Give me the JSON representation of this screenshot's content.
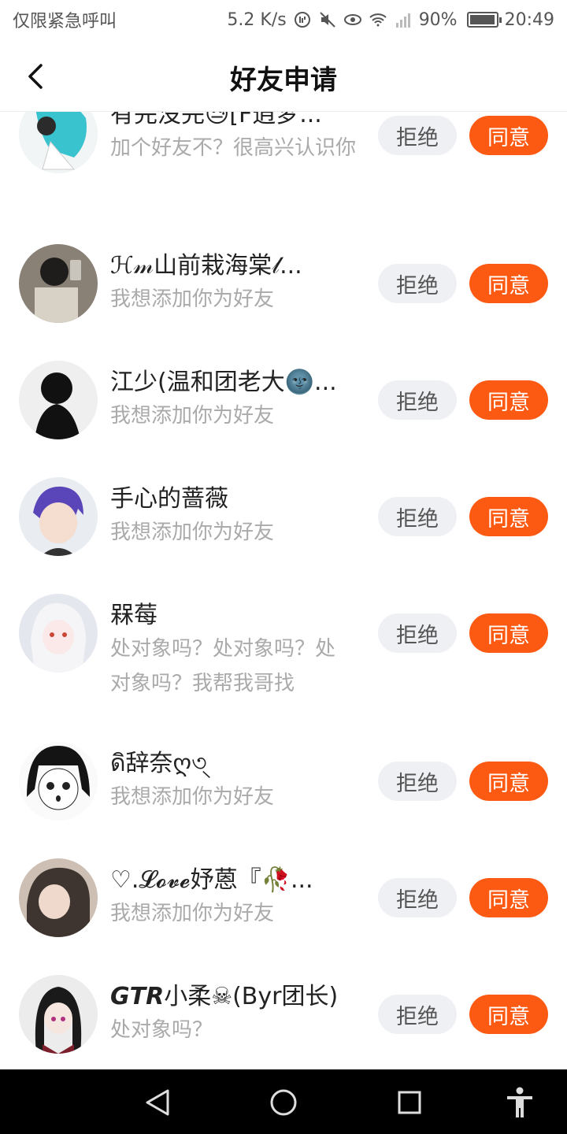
{
  "status_bar": {
    "left_text": "仅限紧急呼叫",
    "speed": "5.2 K/s",
    "battery": "90%",
    "time": "20:49"
  },
  "header": {
    "title": "好友申请",
    "back_icon": "chevron-left-icon"
  },
  "requests": [
    {
      "name": "有完没完😓[F逍梦...",
      "message": "加个好友不？很高兴认识你",
      "reject_label": "拒绝",
      "accept_label": "同意"
    },
    {
      "name": "ℋ𝓂山前栽海棠𝓁...",
      "message": "我想添加你为好友",
      "reject_label": "拒绝",
      "accept_label": "同意"
    },
    {
      "name": "江少(温和团老大🌚...",
      "message": "我想添加你为好友",
      "reject_label": "拒绝",
      "accept_label": "同意"
    },
    {
      "name": "手心的蔷薇",
      "message": "我想添加你为好友",
      "reject_label": "拒绝",
      "accept_label": "同意"
    },
    {
      "name": "槑莓",
      "message": "处对象吗？处对象吗？处对象吗？我帮我哥找",
      "reject_label": "拒绝",
      "accept_label": "同意"
    },
    {
      "name": "ดิ辞奈ღ৩্",
      "message": "我想添加你为好友",
      "reject_label": "拒绝",
      "accept_label": "同意"
    },
    {
      "name": "♡.𝓛𝓸𝓿𝓮妤蒽『🥀...",
      "message": "我想添加你为好友",
      "reject_label": "拒绝",
      "accept_label": "同意"
    },
    {
      "name": "𝙂𝙏𝙍小柔☠(Byr团长)",
      "message": "处对象吗？",
      "reject_label": "拒绝",
      "accept_label": "同意"
    }
  ],
  "nav_bar": {
    "back": "triangle-back-icon",
    "home": "circle-home-icon",
    "recents": "square-recents-icon",
    "accessibility": "accessibility-icon"
  },
  "colors": {
    "accept": "#fc5a12",
    "reject_bg": "#eef0f4",
    "secondary_text": "#aaaaaa"
  }
}
